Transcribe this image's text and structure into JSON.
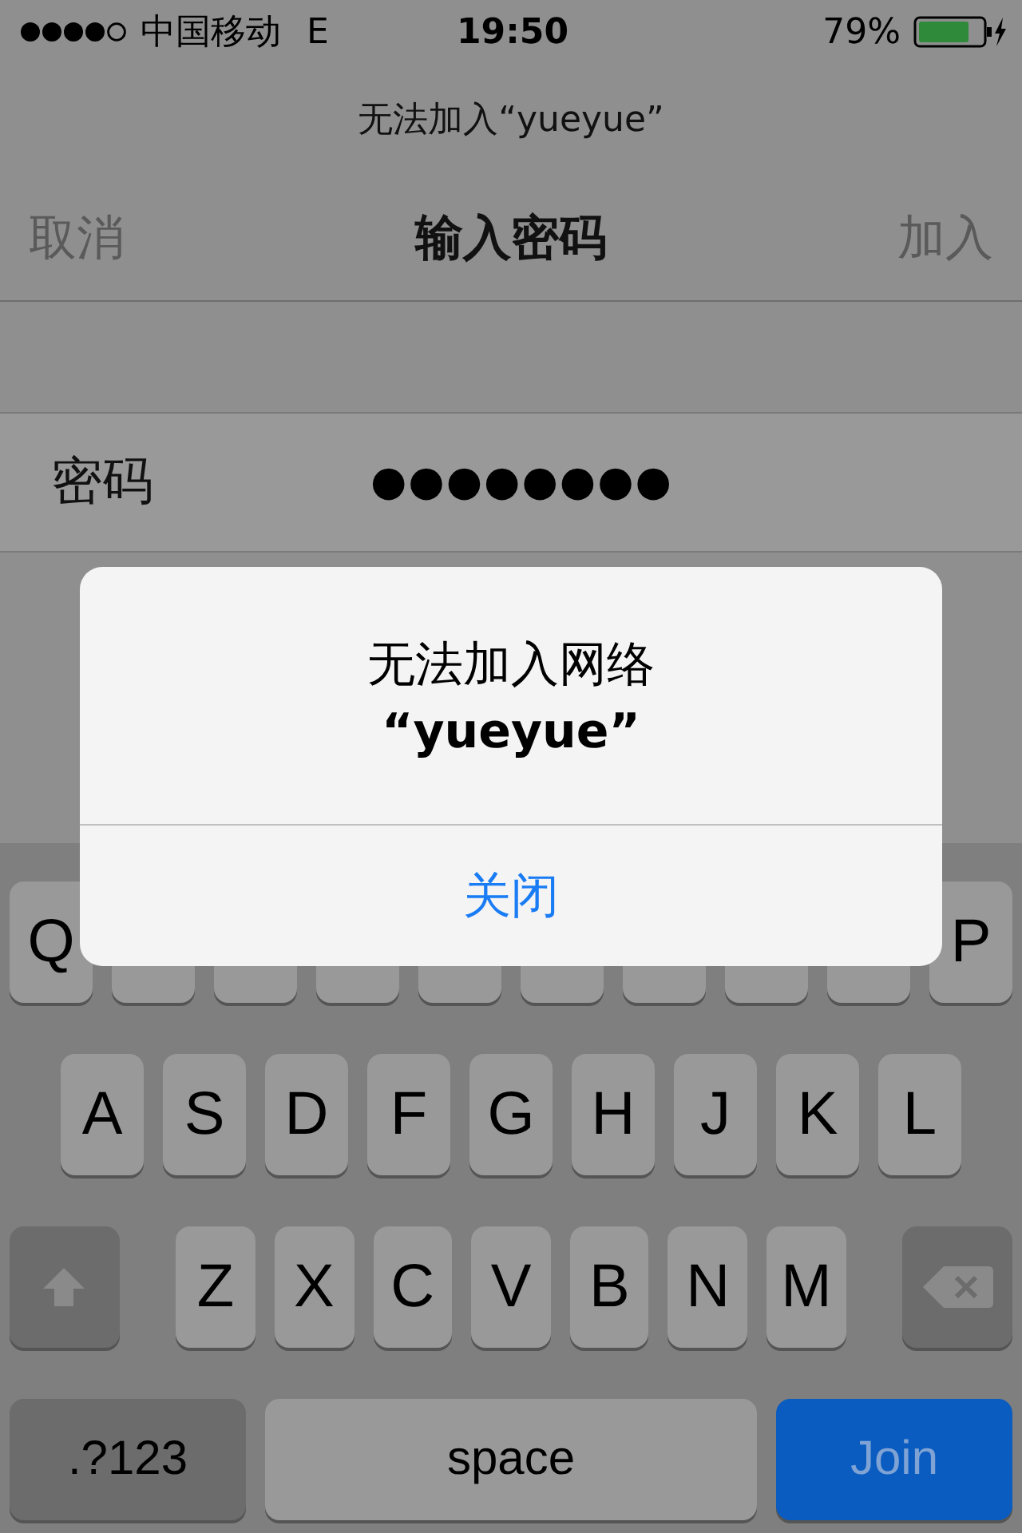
{
  "status_bar": {
    "carrier": "中国移动",
    "network": "E",
    "time": "19:50",
    "battery": "79%"
  },
  "prompt": "无法加入“yueyue”",
  "nav": {
    "cancel": "取消",
    "title": "输入密码",
    "join": "加入"
  },
  "password_row": {
    "label": "密码",
    "value": "●●●●●●●●"
  },
  "alert": {
    "title_lines": [
      "无法加入网络",
      "“yueyue”"
    ],
    "button": "关闭"
  },
  "keyboard": {
    "rows": [
      {
        "keys": [
          {
            "kind": "letter",
            "label": "Q"
          },
          {
            "kind": "letter"
          },
          {
            "kind": "letter"
          },
          {
            "kind": "letter"
          },
          {
            "kind": "letter"
          },
          {
            "kind": "letter"
          },
          {
            "kind": "letter"
          },
          {
            "kind": "letter"
          },
          {
            "kind": "letter"
          },
          {
            "kind": "letter",
            "label": "P"
          }
        ]
      },
      {
        "keys": [
          {
            "kind": "letter",
            "label": "A"
          },
          {
            "kind": "letter",
            "label": "S"
          },
          {
            "kind": "letter",
            "label": "D"
          },
          {
            "kind": "letter",
            "label": "F"
          },
          {
            "kind": "letter",
            "label": "G"
          },
          {
            "kind": "letter",
            "label": "H"
          },
          {
            "kind": "letter",
            "label": "J"
          },
          {
            "kind": "letter",
            "label": "K"
          },
          {
            "kind": "letter",
            "label": "L"
          }
        ]
      },
      {
        "keys": [
          {
            "kind": "shift"
          },
          {
            "kind": "letter",
            "label": "Z"
          },
          {
            "kind": "letter",
            "label": "X"
          },
          {
            "kind": "letter",
            "label": "C"
          },
          {
            "kind": "letter",
            "label": "V"
          },
          {
            "kind": "letter",
            "label": "B"
          },
          {
            "kind": "letter",
            "label": "N"
          },
          {
            "kind": "letter",
            "label": "M"
          },
          {
            "kind": "backspace"
          }
        ]
      },
      {
        "keys": [
          {
            "kind": "mode",
            "label": ".?123"
          },
          {
            "kind": "space",
            "label": "space"
          },
          {
            "kind": "action",
            "label": "Join"
          }
        ]
      }
    ]
  }
}
